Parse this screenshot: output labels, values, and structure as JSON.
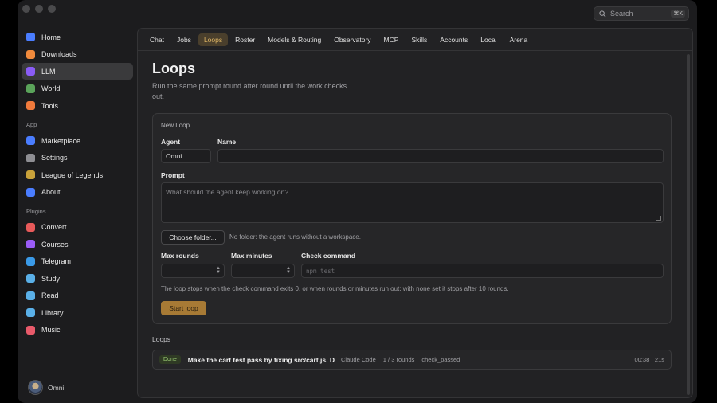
{
  "search": {
    "placeholder": "Search",
    "shortcut": "⌘K"
  },
  "sidebar": {
    "main_items": [
      {
        "label": "Home",
        "icon": "home-icon",
        "color": "#4a7dff"
      },
      {
        "label": "Downloads",
        "icon": "downloads-icon",
        "color": "#f08a3c"
      },
      {
        "label": "LLM",
        "icon": "llm-icon",
        "color": "#8a5cf6",
        "active": true
      },
      {
        "label": "World",
        "icon": "world-icon",
        "color": "#5aa35a"
      },
      {
        "label": "Tools",
        "icon": "tools-icon",
        "color": "#f07a3c"
      }
    ],
    "app_title": "App",
    "app_items": [
      {
        "label": "Marketplace",
        "icon": "marketplace-icon",
        "color": "#4a7dff"
      },
      {
        "label": "Settings",
        "icon": "settings-icon",
        "color": "#8e8e93"
      },
      {
        "label": "League of Legends",
        "icon": "league-icon",
        "color": "#c9a23a"
      },
      {
        "label": "About",
        "icon": "about-icon",
        "color": "#4a7dff"
      }
    ],
    "plugins_title": "Plugins",
    "plugin_items": [
      {
        "label": "Convert",
        "icon": "convert-icon",
        "color": "#e85a5a"
      },
      {
        "label": "Courses",
        "icon": "courses-icon",
        "color": "#9a5cf6"
      },
      {
        "label": "Telegram",
        "icon": "telegram-icon",
        "color": "#3a9ae8"
      },
      {
        "label": "Study",
        "icon": "study-icon",
        "color": "#5ab0e8"
      },
      {
        "label": "Read",
        "icon": "read-icon",
        "color": "#5ab0e8"
      },
      {
        "label": "Library",
        "icon": "library-icon",
        "color": "#5ab0e8"
      },
      {
        "label": "Music",
        "icon": "music-icon",
        "color": "#e85a6a"
      }
    ],
    "user": "Omni"
  },
  "tabs": [
    {
      "label": "Chat"
    },
    {
      "label": "Jobs"
    },
    {
      "label": "Loops",
      "active": true
    },
    {
      "label": "Roster"
    },
    {
      "label": "Models & Routing"
    },
    {
      "label": "Observatory"
    },
    {
      "label": "MCP"
    },
    {
      "label": "Skills"
    },
    {
      "label": "Accounts"
    },
    {
      "label": "Local"
    },
    {
      "label": "Arena"
    }
  ],
  "page": {
    "title": "Loops",
    "subtitle": "Run the same prompt round after round until the work checks out."
  },
  "form": {
    "card_title": "New Loop",
    "agent_label": "Agent",
    "agent_value": "Omni",
    "name_label": "Name",
    "name_value": "",
    "prompt_label": "Prompt",
    "prompt_placeholder": "What should the agent keep working on?",
    "choose_folder": "Choose folder...",
    "folder_note": "No folder: the agent runs without a workspace.",
    "max_rounds_label": "Max rounds",
    "max_minutes_label": "Max minutes",
    "check_command_label": "Check command",
    "check_command_placeholder": "npm test",
    "help_note": "The loop stops when the check command exits 0, or when rounds or minutes run out; with none set it stops after 10 rounds.",
    "start_button": "Start loop"
  },
  "loops": {
    "title": "Loops",
    "rows": [
      {
        "status": "Done",
        "name": "Make the cart test pass by fixing src/cart.js. D",
        "agent": "Claude Code",
        "rounds": "1 / 3 rounds",
        "result": "check_passed",
        "time": "00:38 · 21s"
      }
    ]
  }
}
